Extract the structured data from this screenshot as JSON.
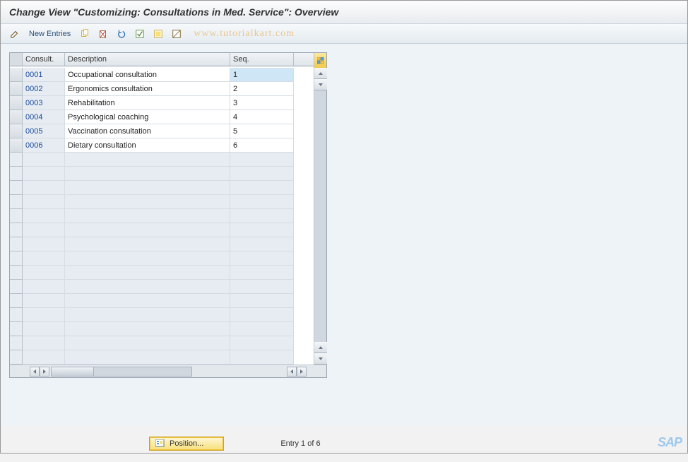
{
  "title": "Change View \"Customizing: Consultations in Med. Service\": Overview",
  "toolbar": {
    "new_entries_label": "New Entries"
  },
  "watermark": "www.tutorialkart.com",
  "columns": {
    "consult": "Consult.",
    "description": "Description",
    "seq": "Seq."
  },
  "rows": [
    {
      "consult": "0001",
      "description": "Occupational consultation",
      "seq": "1"
    },
    {
      "consult": "0002",
      "description": "Ergonomics consultation",
      "seq": "2"
    },
    {
      "consult": "0003",
      "description": "Rehabilitation",
      "seq": "3"
    },
    {
      "consult": "0004",
      "description": "Psychological coaching",
      "seq": "4"
    },
    {
      "consult": "0005",
      "description": "Vaccination consultation",
      "seq": "5"
    },
    {
      "consult": "0006",
      "description": "Dietary consultation",
      "seq": "6"
    }
  ],
  "empty_row_count": 15,
  "footer": {
    "position_label": "Position...",
    "entry_label": "Entry 1 of 6"
  },
  "logo": "SAP"
}
